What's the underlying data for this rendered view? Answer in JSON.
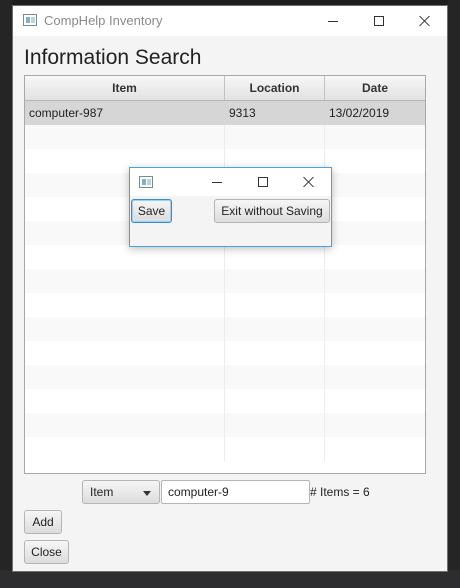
{
  "window": {
    "title": "CompHelp Inventory"
  },
  "heading": "Information Search",
  "table": {
    "columns": [
      "Item",
      "Location",
      "Date"
    ],
    "rows": [
      {
        "item": "computer-987",
        "location": "9313",
        "date": "13/02/2019"
      }
    ],
    "selected_row": 0
  },
  "search": {
    "field_select": "Item",
    "query": "computer-9",
    "count_text": "# Items = 6"
  },
  "buttons": {
    "add": "Add",
    "close": "Close"
  },
  "dialog": {
    "save": "Save",
    "exit": "Exit without Saving"
  },
  "colors": {
    "selected_row": "#d6d6d6",
    "focus_border": "#2f8fd8"
  }
}
